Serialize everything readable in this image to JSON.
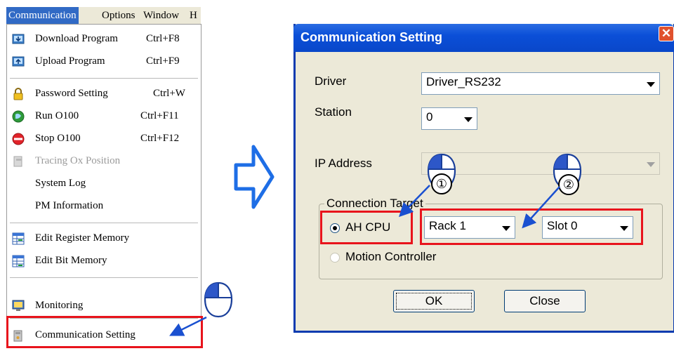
{
  "menubar": {
    "items": [
      "Communication",
      "Options",
      "Window",
      "H"
    ]
  },
  "menu": {
    "items": [
      {
        "label": "Download Program",
        "shortcut": "Ctrl+F8",
        "icon": "download-icon",
        "disabled": false
      },
      {
        "label": "Upload Program",
        "shortcut": "Ctrl+F9",
        "icon": "upload-icon",
        "disabled": false
      },
      {
        "label": "Password Setting",
        "shortcut": "Ctrl+W",
        "icon": "lock-icon",
        "disabled": false
      },
      {
        "label": "Run O100",
        "shortcut": "Ctrl+F11",
        "icon": "run-icon",
        "disabled": false
      },
      {
        "label": "Stop O100",
        "shortcut": "Ctrl+F12",
        "icon": "stop-icon",
        "disabled": false
      },
      {
        "label": "Tracing Ox Position",
        "shortcut": "",
        "icon": "tracing-icon",
        "disabled": true
      },
      {
        "label": "System Log",
        "shortcut": "",
        "icon": "",
        "disabled": false
      },
      {
        "label": "PM Information",
        "shortcut": "",
        "icon": "",
        "disabled": false
      },
      {
        "label": "Edit Register Memory",
        "shortcut": "",
        "icon": "register-memory-icon",
        "disabled": false
      },
      {
        "label": "Edit Bit Memory",
        "shortcut": "",
        "icon": "bit-memory-icon",
        "disabled": false
      },
      {
        "label": "Monitoring",
        "shortcut": "",
        "icon": "monitor-icon",
        "disabled": false
      },
      {
        "label": "Communication Setting",
        "shortcut": "",
        "icon": "communication-icon",
        "disabled": false
      }
    ]
  },
  "dialog": {
    "title": "Communication Setting",
    "driver_label": "Driver",
    "driver_value": "Driver_RS232",
    "station_label": "Station",
    "station_value": "0",
    "ip_label": "IP Address",
    "ip_value": "",
    "group_title": "Connection Target",
    "radio_ah": "AH CPU",
    "radio_motion": "Motion Controller",
    "rack_value": "Rack 1",
    "slot_value": "Slot 0",
    "ok_label": "OK",
    "close_label": "Close"
  },
  "annotations": {
    "step1": "①",
    "step2": "②"
  },
  "colors": {
    "highlight": "#e8141c",
    "title_bar": "#0b4fd8",
    "arrow": "#1e6ee6",
    "mouse_blue": "#2d57c8"
  }
}
